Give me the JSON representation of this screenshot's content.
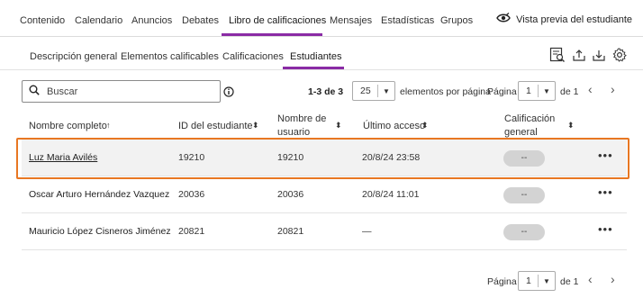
{
  "topnav": {
    "tabs": [
      "Contenido",
      "Calendario",
      "Anuncios",
      "Debates",
      "Libro de calificaciones",
      "Mensajes",
      "Estadísticas",
      "Grupos"
    ],
    "active_index": 4,
    "preview_label": "Vista previa del estudiante"
  },
  "subnav": {
    "tabs": [
      "Descripción general",
      "Elementos calificables",
      "Calificaciones",
      "Estudiantes"
    ],
    "active_index": 3
  },
  "toolbar": {
    "search_placeholder": "Buscar",
    "range_text": "1-3 de 3",
    "per_page_value": "25",
    "per_page_label": "elementos por página",
    "page_label": "Página",
    "page_value": "1",
    "page_of": "de 1"
  },
  "table": {
    "headers": {
      "name": "Nombre completo",
      "student_id": "ID del estudiante",
      "username_line1": "Nombre de",
      "username_line2": "usuario",
      "last_access": "Último acceso",
      "grade_line1": "Calificación",
      "grade_line2": "general"
    },
    "rows": [
      {
        "name": "Luz Maria Avilés",
        "student_id": "19210",
        "username": "19210",
        "last_access": "20/8/24 23:58",
        "grade": "--"
      },
      {
        "name": "Oscar Arturo Hernández Vazquez",
        "student_id": "20036",
        "username": "20036",
        "last_access": "20/8/24 11:01",
        "grade": "--"
      },
      {
        "name": "Mauricio López Cisneros Jiménez",
        "student_id": "20821",
        "username": "20821",
        "last_access": "—",
        "grade": "--"
      }
    ],
    "more_label": "•••"
  },
  "footer": {
    "page_label": "Página",
    "page_value": "1",
    "page_of": "de 1"
  },
  "colors": {
    "accent": "#8a2ba5",
    "highlight": "#e87722"
  }
}
